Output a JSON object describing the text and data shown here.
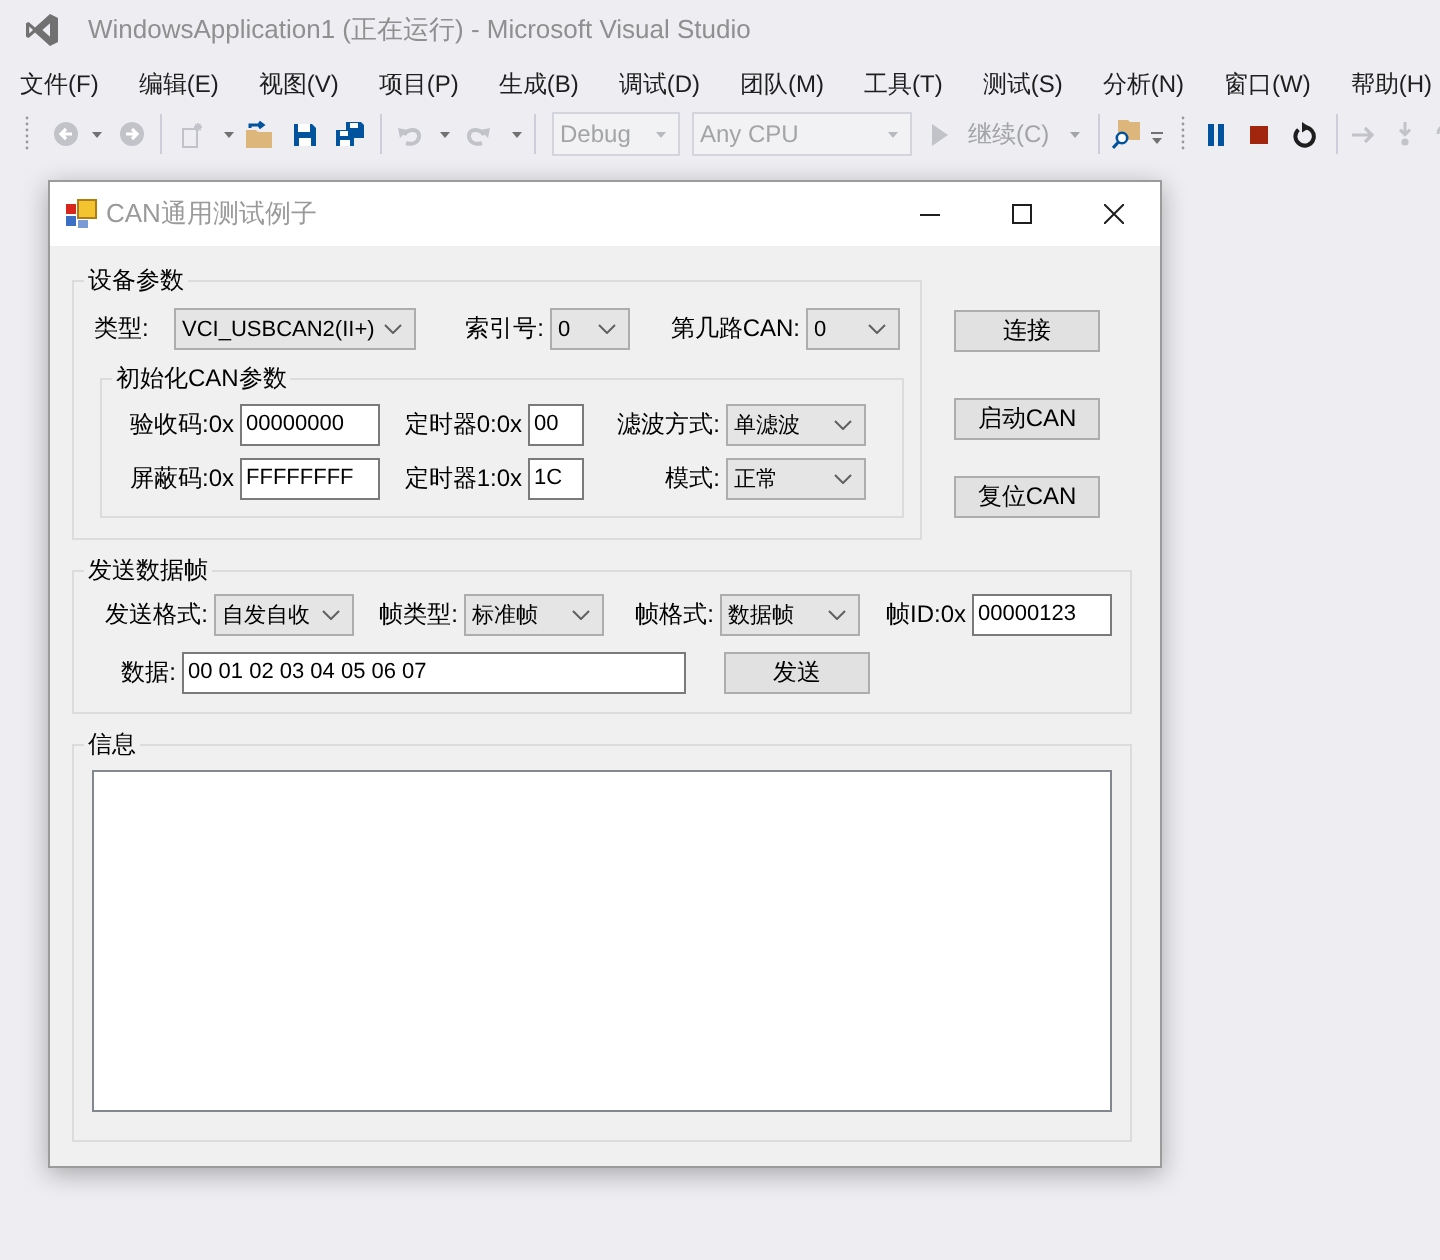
{
  "ide": {
    "title": "WindowsApplication1 (正在运行) - Microsoft Visual Studio",
    "menu": [
      "文件(F)",
      "编辑(E)",
      "视图(V)",
      "项目(P)",
      "生成(B)",
      "调试(D)",
      "团队(M)",
      "工具(T)",
      "测试(S)",
      "分析(N)",
      "窗口(W)",
      "帮助(H)"
    ],
    "toolbar": {
      "configuration": {
        "value": "Debug",
        "disabled": true
      },
      "platform": {
        "value": "Any CPU",
        "disabled": true
      },
      "continue": {
        "label": "继续(C)",
        "disabled": true
      }
    }
  },
  "dialog": {
    "title": "CAN通用测试例子",
    "device_group": {
      "title": "设备参数",
      "fields": [
        {
          "label": "类型:",
          "value": "VCI_USBCAN2(II+)"
        },
        {
          "label": "索引号:",
          "value": "0"
        },
        {
          "label": "第几路CAN:",
          "value": "0"
        }
      ],
      "init_group": {
        "title": "初始化CAN参数",
        "rows": [
          [
            {
              "kind": "text",
              "label": "验收码:0x",
              "value": "00000000"
            },
            {
              "kind": "text",
              "label": "定时器0:0x",
              "value": "00"
            },
            {
              "kind": "dropdown",
              "label": "滤波方式:",
              "value": "单滤波"
            }
          ],
          [
            {
              "kind": "text",
              "label": "屏蔽码:0x",
              "value": "FFFFFFFF"
            },
            {
              "kind": "text",
              "label": "定时器1:0x",
              "value": "1C"
            },
            {
              "kind": "dropdown",
              "label": "模式:",
              "value": "正常"
            }
          ]
        ]
      }
    },
    "buttons": [
      "连接",
      "启动CAN",
      "复位CAN"
    ],
    "send_group": {
      "title": "发送数据帧",
      "fields": [
        {
          "kind": "dropdown",
          "label": "发送格式:",
          "value": "自发自收"
        },
        {
          "kind": "dropdown",
          "label": "帧类型:",
          "value": "标准帧"
        },
        {
          "kind": "dropdown",
          "label": "帧格式:",
          "value": "数据帧"
        },
        {
          "kind": "text",
          "label": "帧ID:0x",
          "value": "00000123"
        }
      ],
      "data": {
        "label": "数据:",
        "value": "00 01 02 03 04 05 06 07"
      },
      "send_button": "发送"
    },
    "info_group": {
      "title": "信息"
    }
  }
}
